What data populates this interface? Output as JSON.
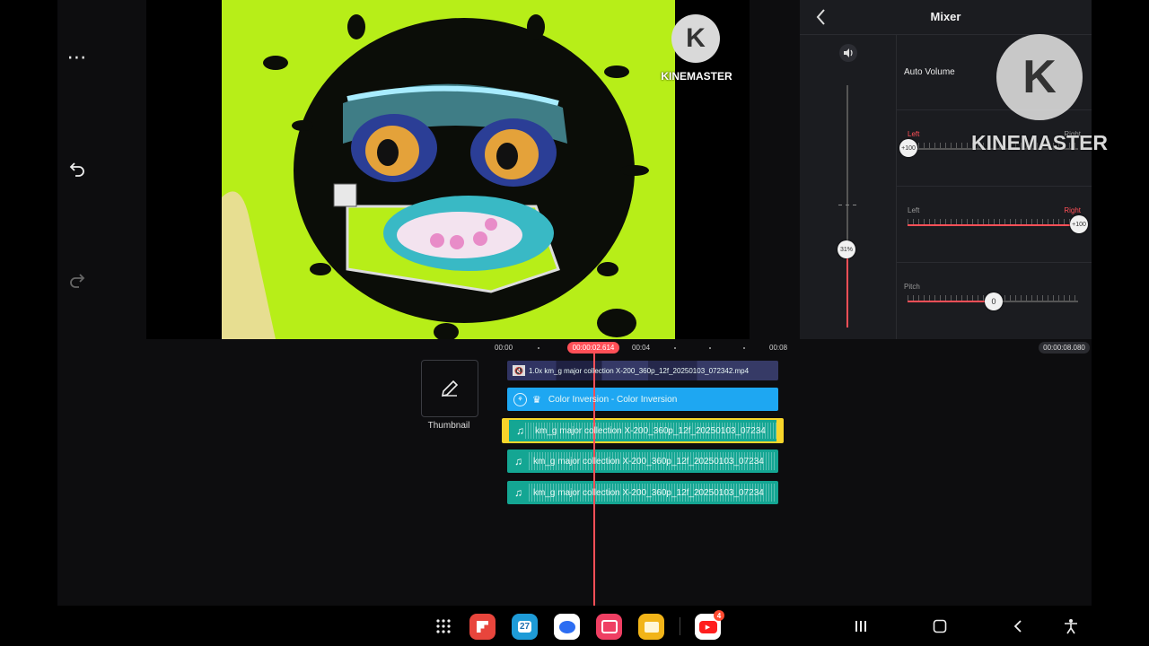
{
  "toolbar": {
    "more_icon": "more-horizontal-icon",
    "undo_icon": "undo-icon",
    "redo_icon": "redo-icon"
  },
  "preview": {
    "watermark_text": "KINEMASTER",
    "watermark_letter": "K"
  },
  "mixer": {
    "title": "Mixer",
    "back_icon": "chevron-left-icon",
    "volume_icon": "speaker-icon",
    "volume_value": "31%",
    "volume_level_percent": 31,
    "auto_volume_label": "Auto Volume",
    "pan_left": {
      "left_label": "Left",
      "right_label": "Right",
      "value": "+100"
    },
    "pan_right": {
      "left_label": "Left",
      "right_label": "Right",
      "value": "+100"
    },
    "pitch_label": "Pitch",
    "pitch_value": "0",
    "watermark_text": "KINEMASTER",
    "watermark_letter": "K",
    "accent_color": "#ff4f57"
  },
  "timeline": {
    "ruler": [
      "00:00",
      "00:04",
      "00:08"
    ],
    "playhead_time": "00:00:02.614",
    "total_time": "00:00:08.080",
    "layer_icon": "layers-icon",
    "thumbnail_label": "Thumbnail",
    "thumbnail_icon": "pencil-icon",
    "video_clip_label": "1.0x km_g major collection X-200_360p_12f_20250103_072342.mp4",
    "effect_label": "Color Inversion - Color Inversion",
    "audio_tracks": [
      {
        "label": "km_g major collection X-200_360p_12f_20250103_07234",
        "selected": true
      },
      {
        "label": "km_g major collection X-200_360p_12f_20250103_07234",
        "selected": false
      },
      {
        "label": "km_g major collection X-200_360p_12f_20250103_07234",
        "selected": false
      }
    ],
    "colors": {
      "effect": "#1ea7f2",
      "audio": "#14a693",
      "selected_border": "#f7d52a",
      "playhead": "#ff4f57"
    }
  },
  "taskbar": {
    "apps": [
      {
        "name": "apps-grid-icon"
      },
      {
        "name": "flipboard-icon",
        "color": "#e8453c"
      },
      {
        "name": "calendar-icon",
        "label": "27",
        "color": "#1e9bd7"
      },
      {
        "name": "messages-icon",
        "color": "#2c6df2"
      },
      {
        "name": "camera-icon",
        "color": "#ef3f63"
      },
      {
        "name": "files-icon",
        "color": "#f2b418"
      },
      {
        "name": "youtube-icon",
        "badge": "4",
        "color": "#ff1e1e"
      }
    ],
    "nav": [
      "recents-icon",
      "home-icon",
      "back-icon",
      "accessibility-icon"
    ]
  }
}
